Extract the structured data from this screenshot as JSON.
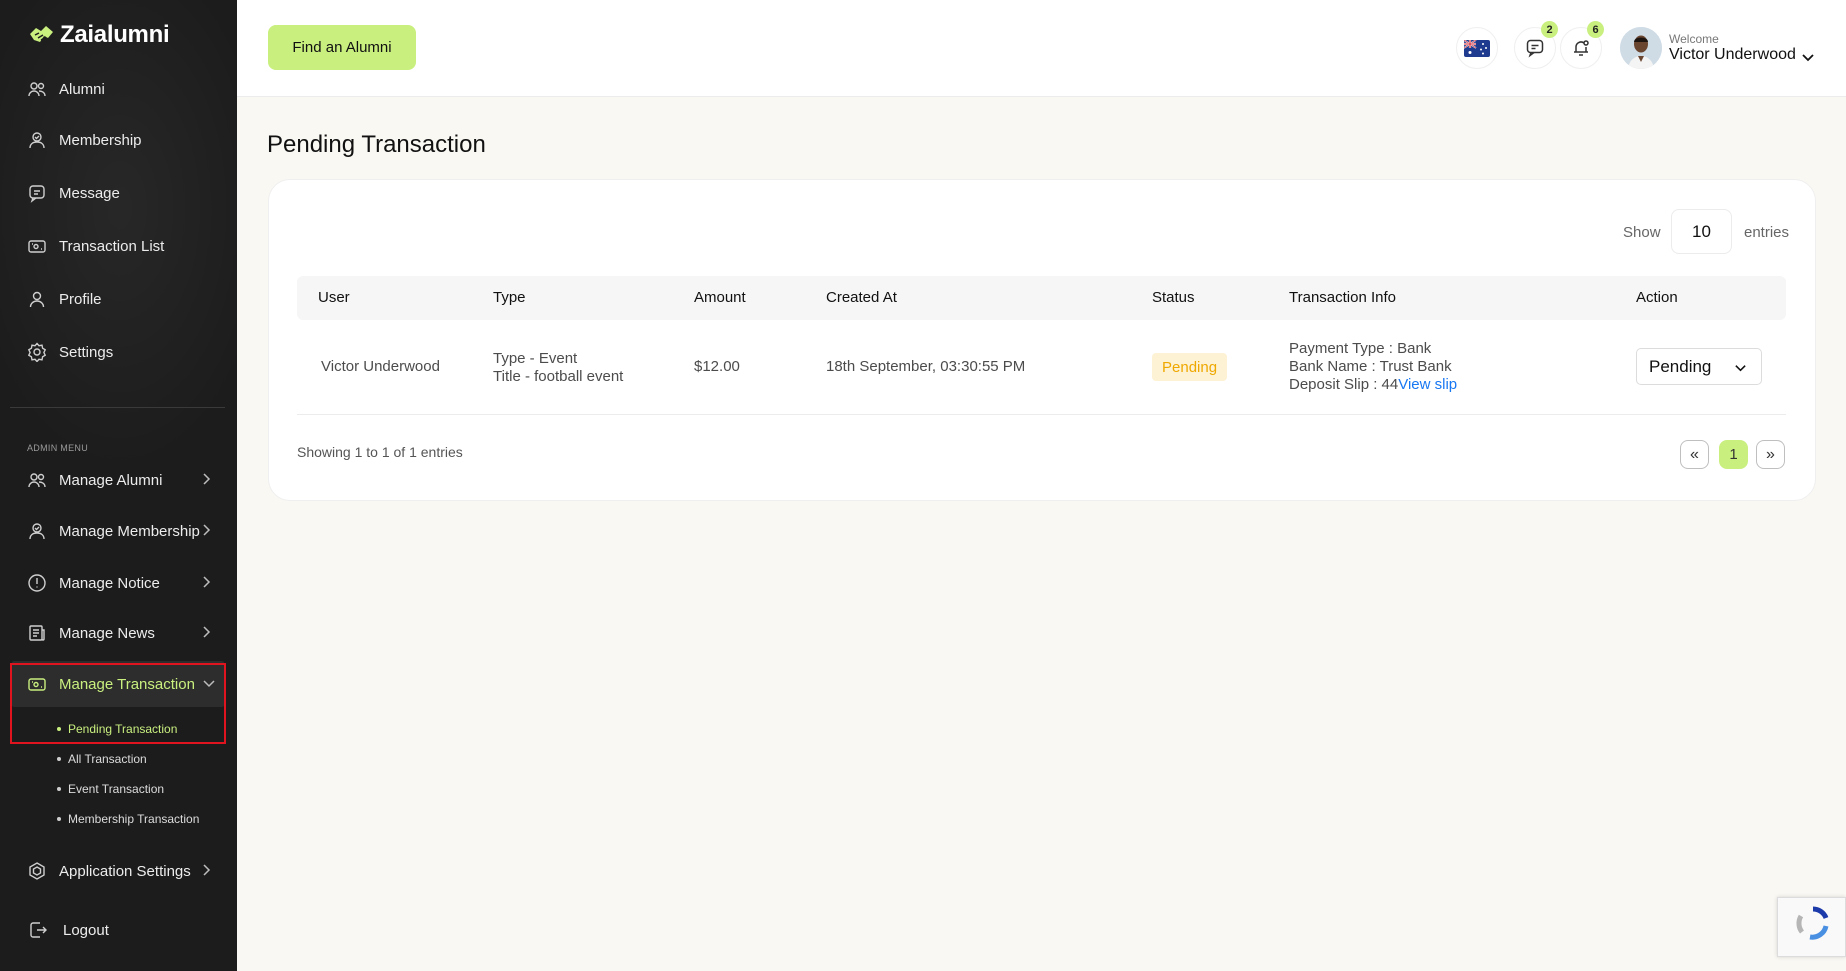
{
  "app": {
    "name": "Zaialumni"
  },
  "sidebar": {
    "items": [
      {
        "label": "Alumni",
        "icon": "users-icon"
      },
      {
        "label": "Membership",
        "icon": "membership-icon"
      },
      {
        "label": "Message",
        "icon": "message-icon"
      },
      {
        "label": "Transaction List",
        "icon": "wallet-icon"
      },
      {
        "label": "Profile",
        "icon": "user-icon"
      },
      {
        "label": "Settings",
        "icon": "gear-icon"
      }
    ],
    "admin_label": "ADMIN MENU",
    "admin_items": [
      {
        "label": "Manage Alumni",
        "icon": "users-icon"
      },
      {
        "label": "Manage Membership",
        "icon": "membership-icon"
      },
      {
        "label": "Manage Notice",
        "icon": "alert-icon"
      },
      {
        "label": "Manage News",
        "icon": "news-icon"
      },
      {
        "label": "Manage Transaction",
        "icon": "wallet-icon",
        "active": true
      }
    ],
    "sub_items": [
      {
        "label": "Pending Transaction",
        "active": true
      },
      {
        "label": "All Transaction"
      },
      {
        "label": "Event Transaction"
      },
      {
        "label": "Membership Transaction"
      }
    ],
    "app_settings": "Application Settings",
    "logout": "Logout"
  },
  "header": {
    "find_button": "Find an Alumni",
    "message_count": "2",
    "notification_count": "6",
    "welcome": "Welcome",
    "username": "Victor Underwood"
  },
  "main": {
    "title": "Pending Transaction",
    "show_label": "Show",
    "entries_value": "10",
    "entries_label": "entries",
    "columns": [
      "User",
      "Type",
      "Amount",
      "Created At",
      "Status",
      "Transaction Info",
      "Action"
    ],
    "rows": [
      {
        "user": "Victor Underwood",
        "type_line1": "Type - Event",
        "type_line2": "Title - football event",
        "amount": "$12.00",
        "created_at": "18th September, 03:30:55 PM",
        "status": "Pending",
        "info_payment_type": "Payment Type : Bank",
        "info_bank_name": "Bank Name : Trust Bank",
        "info_deposit_slip": "Deposit Slip : 44",
        "info_view_slip": "View slip",
        "action": "Pending"
      }
    ],
    "showing_text": "Showing 1 to 1 of 1 entries",
    "pagination": {
      "prev": "«",
      "current": "1",
      "next": "»"
    }
  },
  "colors": {
    "accent": "#c9ef7f",
    "sidebar_bg": "#1c1c1c",
    "pending": "#efa800",
    "link": "#1877f2"
  }
}
